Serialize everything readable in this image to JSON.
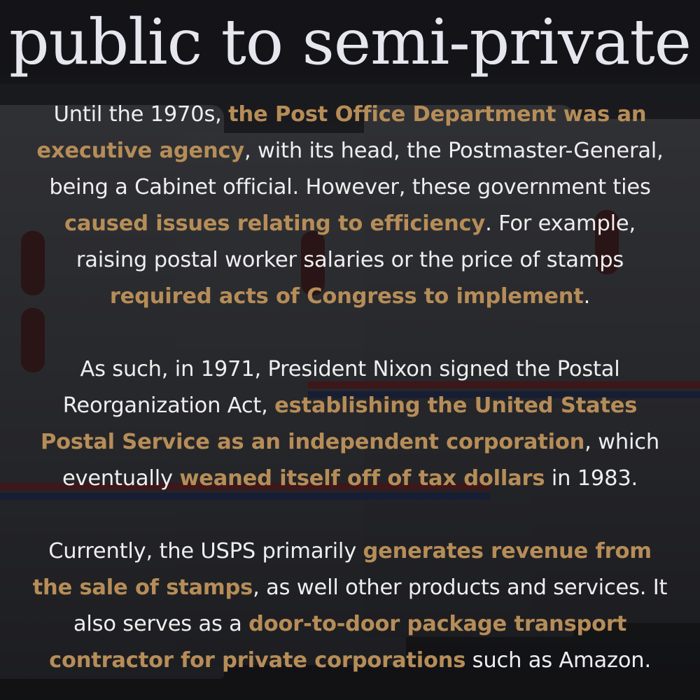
{
  "title": "public to semi-private",
  "paragraphs": [
    {
      "lines": [
        [
          {
            "text": "Until the 1970s, "
          },
          {
            "text": "the Post Office Department was an",
            "hl": true
          }
        ],
        [
          {
            "text": "executive agency",
            "hl": true
          },
          {
            "text": ", with its head, the Postmaster-General,"
          }
        ],
        [
          {
            "text": "being a Cabinet official. However, these government ties"
          }
        ],
        [
          {
            "text": "caused issues relating to efficiency",
            "hl": true
          },
          {
            "text": ". For example,"
          }
        ],
        [
          {
            "text": "raising postal worker salaries or the price of stamps"
          }
        ],
        [
          {
            "text": "required acts of Congress to implement",
            "hl": true
          },
          {
            "text": "."
          }
        ]
      ]
    },
    {
      "lines": [
        [
          {
            "text": "As such, in 1971, President Nixon signed the Postal"
          }
        ],
        [
          {
            "text": "Reorganization Act, "
          },
          {
            "text": "establishing the United States",
            "hl": true
          }
        ],
        [
          {
            "text": "Postal Service as an independent corporation",
            "hl": true
          },
          {
            "text": ", which"
          }
        ],
        [
          {
            "text": "eventually "
          },
          {
            "text": "weaned itself off of tax dollars",
            "hl": true
          },
          {
            "text": " in 1983."
          }
        ]
      ]
    },
    {
      "lines": [
        [
          {
            "text": "Currently, the USPS primarily "
          },
          {
            "text": "generates revenue from",
            "hl": true
          }
        ],
        [
          {
            "text": "the sale of stamps",
            "hl": true
          },
          {
            "text": ", as well other products and services. It"
          }
        ],
        [
          {
            "text": "also serves as a "
          },
          {
            "text": "door-to-door package transport",
            "hl": true
          }
        ],
        [
          {
            "text": "contractor for private corporations",
            "hl": true
          },
          {
            "text": " such as Amazon."
          }
        ]
      ]
    }
  ],
  "colors": {
    "title": "#e6e7ee",
    "body_text": "#eeeeee",
    "highlight": "#b68d58",
    "overlay": "rgba(12,12,14,0.62)"
  }
}
